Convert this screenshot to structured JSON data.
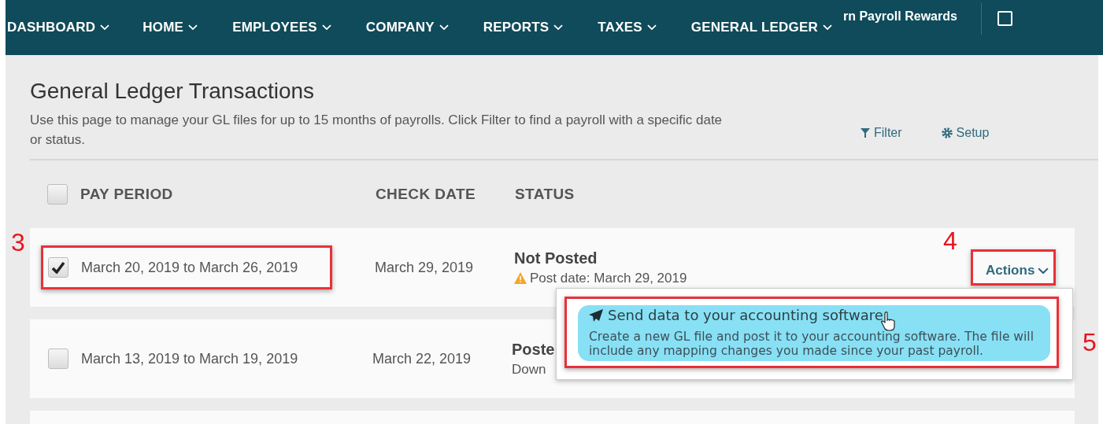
{
  "nav": {
    "items": [
      {
        "label": "DASHBOARD"
      },
      {
        "label": "HOME"
      },
      {
        "label": "EMPLOYEES"
      },
      {
        "label": "COMPANY"
      },
      {
        "label": "REPORTS"
      },
      {
        "label": "TAXES"
      },
      {
        "label": "GENERAL LEDGER"
      }
    ],
    "promo": "rn Payroll Rewards"
  },
  "page": {
    "title": "General Ledger Transactions",
    "description": "Use this page to manage your GL files for up to 15 months of payrolls. Click Filter to find a payroll with a specific date or status.",
    "filter": "Filter",
    "setup": "Setup"
  },
  "table": {
    "select_all": {
      "checked": false
    },
    "columns": [
      "PAY PERIOD",
      "CHECK DATE",
      "STATUS"
    ],
    "rows": [
      {
        "checked": true,
        "pay_period": "March 20, 2019 to March 26, 2019",
        "check_date": "March 29, 2019",
        "status": "Not Posted",
        "detail": "Post date: March 29, 2019",
        "kind": "warning",
        "actions": "Actions"
      },
      {
        "checked": false,
        "pay_period": "March 13, 2019 to March 19, 2019",
        "check_date": "March 22, 2019",
        "status": "Poste",
        "detail": "Down",
        "kind": "plain"
      }
    ]
  },
  "actions_menu": {
    "items": [
      {
        "title": "Send data to your accounting software",
        "description": "Create a new GL file and post it to your accounting software. The file will include any mapping changes you made since your past payroll.",
        "selected": true
      }
    ]
  },
  "annotations": [
    "3",
    "4",
    "5"
  ]
}
